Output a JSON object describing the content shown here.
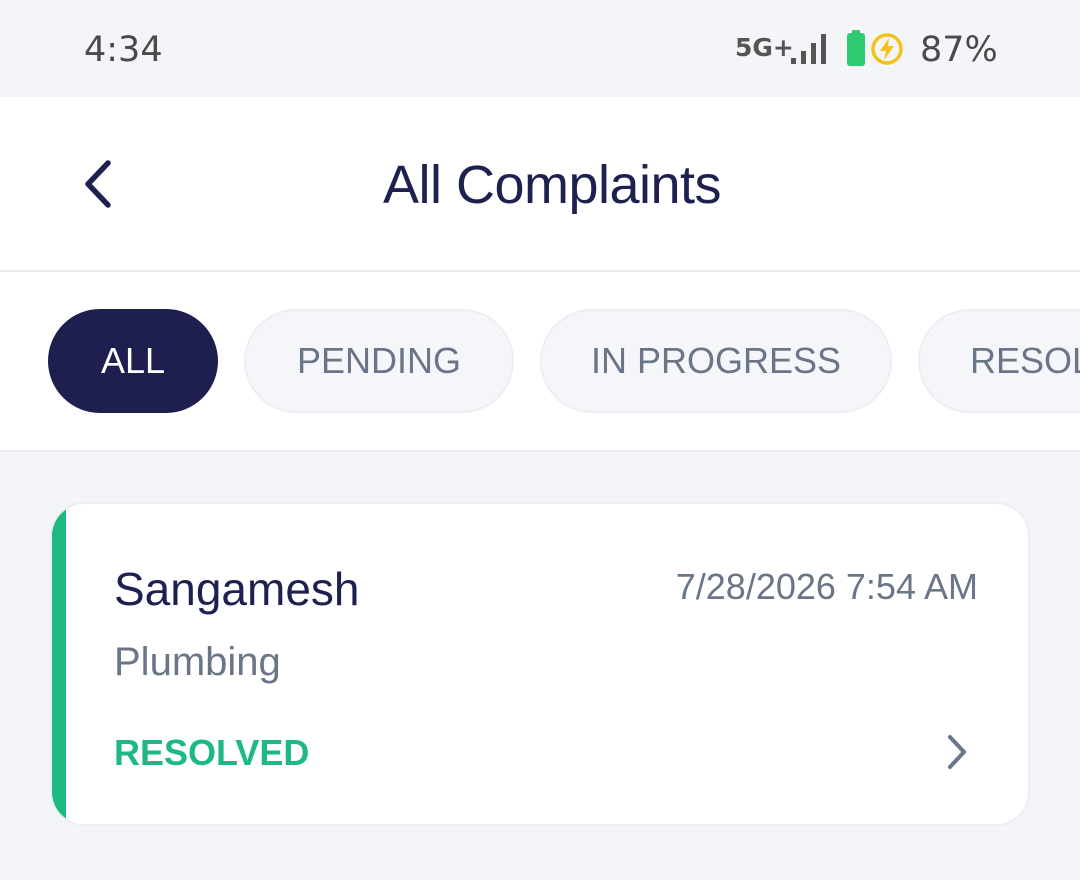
{
  "status_bar": {
    "time": "4:34",
    "network": "5G+",
    "battery_percent": "87%",
    "icons": [
      "signal-icon",
      "battery-icon",
      "charging-icon"
    ]
  },
  "header": {
    "title": "All Complaints",
    "back_icon": "chevron-left-icon"
  },
  "filters": {
    "active": "ALL",
    "items": [
      {
        "label": "ALL"
      },
      {
        "label": "PENDING"
      },
      {
        "label": "IN PROGRESS"
      },
      {
        "label": "RESOLVED"
      }
    ]
  },
  "complaints": [
    {
      "name": "Sangamesh",
      "date": "7/28/2026 7:54 AM",
      "category": "Plumbing",
      "status": "RESOLVED",
      "chevron_icon": "chevron-right-icon"
    }
  ],
  "colors": {
    "primary": "#1e1f4f",
    "resolved": "#1db981",
    "muted_text": "#6a7587",
    "background": "#f4f5f8"
  }
}
